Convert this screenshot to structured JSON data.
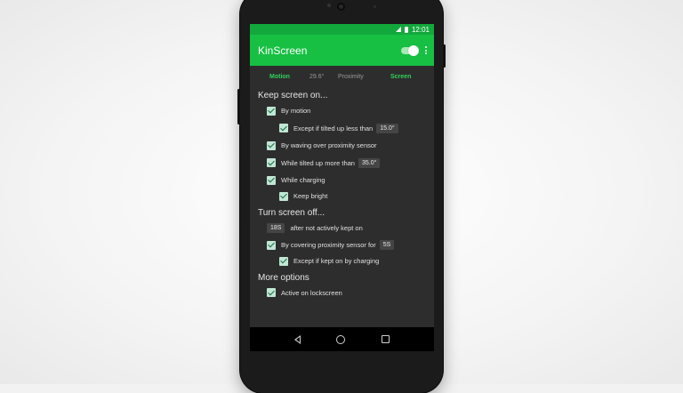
{
  "status_bar": {
    "time": "12:01"
  },
  "app_bar": {
    "title": "KinScreen",
    "toggle_on": true
  },
  "tabs": {
    "motion": "Motion",
    "angle": "29.6°",
    "proximity": "Proximity",
    "screen": "Screen"
  },
  "keep_on": {
    "header": "Keep screen on...",
    "by_motion": "By motion",
    "except_tilted": "Except if tilted up less than",
    "except_tilted_value": "15.0°",
    "by_waving": "By waving over proximity sensor",
    "while_tilted": "While tilted up more than",
    "while_tilted_value": "35.0°",
    "while_charging": "While charging",
    "keep_bright": "Keep bright"
  },
  "turn_off": {
    "header": "Turn screen off...",
    "timeout_value": "18S",
    "timeout_text": "after not actively kept on",
    "by_covering": "By covering proximity sensor for",
    "by_covering_value": "5S",
    "except_charging": "Except if kept on by charging"
  },
  "more": {
    "header": "More options",
    "active_lockscreen": "Active on lockscreen"
  },
  "colors": {
    "accent": "#17c043",
    "status": "#13a83c",
    "active_tab": "#2fd35a",
    "background": "#2d2d2d"
  },
  "icons": [
    "signal-icon",
    "battery-icon",
    "overflow-menu-icon",
    "back-icon",
    "home-icon",
    "recents-icon",
    "checkbox-checked-icon"
  ]
}
